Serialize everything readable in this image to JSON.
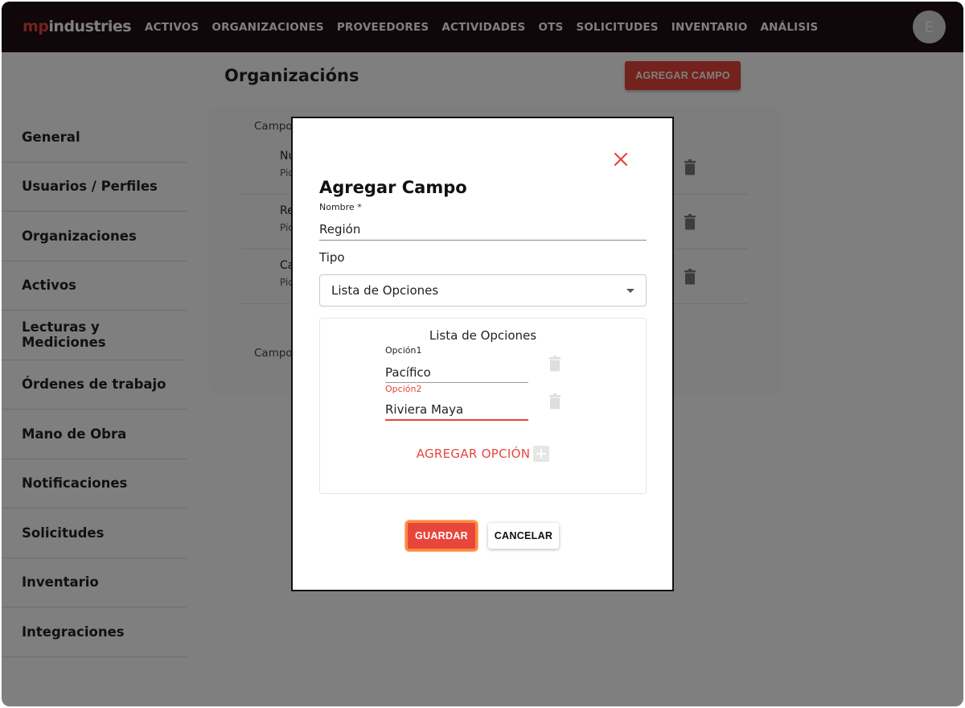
{
  "app": {
    "logo_prefix": "mp",
    "logo_suffix": "industries",
    "avatar_initial": "E"
  },
  "nav": {
    "items": [
      "ACTIVOS",
      "ORGANIZACIONES",
      "PROVEEDORES",
      "ACTIVIDADES",
      "OTS",
      "SOLICITUDES",
      "INVENTARIO",
      "ANÁLISIS"
    ]
  },
  "sidebar": {
    "items": [
      "General",
      "Usuarios / Perfiles",
      "Organizaciones",
      "Activos",
      "Lecturas y Mediciones",
      "Órdenes de trabajo",
      "Mano de Obra",
      "Notificaciones",
      "Solicitudes",
      "Inventario",
      "Integraciones"
    ]
  },
  "main": {
    "title": "Organizacións",
    "add_field_label": "AGREGAR CAMPO",
    "section_label_1": "Campo",
    "section_label_2": "Campo",
    "rows": [
      {
        "name": "Nu",
        "type": "Pic"
      },
      {
        "name": "Re",
        "type": "Pic"
      },
      {
        "name": "Ca",
        "type": "Pic"
      }
    ]
  },
  "modal": {
    "title": "Agregar Campo",
    "name_label": "Nombre *",
    "name_value": "Región",
    "tipo_label": "Tipo",
    "tipo_value": "Lista de Opciones",
    "options_title": "Lista de Opciones",
    "options": [
      {
        "label": "Opción1",
        "value": "Pacífico",
        "label_color": "#222222"
      },
      {
        "label": "Opción2",
        "value": "Riviera Maya",
        "label_color": "#e8453c"
      }
    ],
    "add_option_label": "AGREGAR OPCIÓN",
    "save_label": "GUARDAR",
    "cancel_label": "CANCELAR"
  },
  "colors": {
    "accent": "#e8453c",
    "topbar": "#1e0f14",
    "focus_ring": "#ff8a3d"
  },
  "icons": {
    "close": "close-icon",
    "trash": "trash-icon",
    "caret": "chevron-down-icon",
    "plus": "plus-icon"
  }
}
